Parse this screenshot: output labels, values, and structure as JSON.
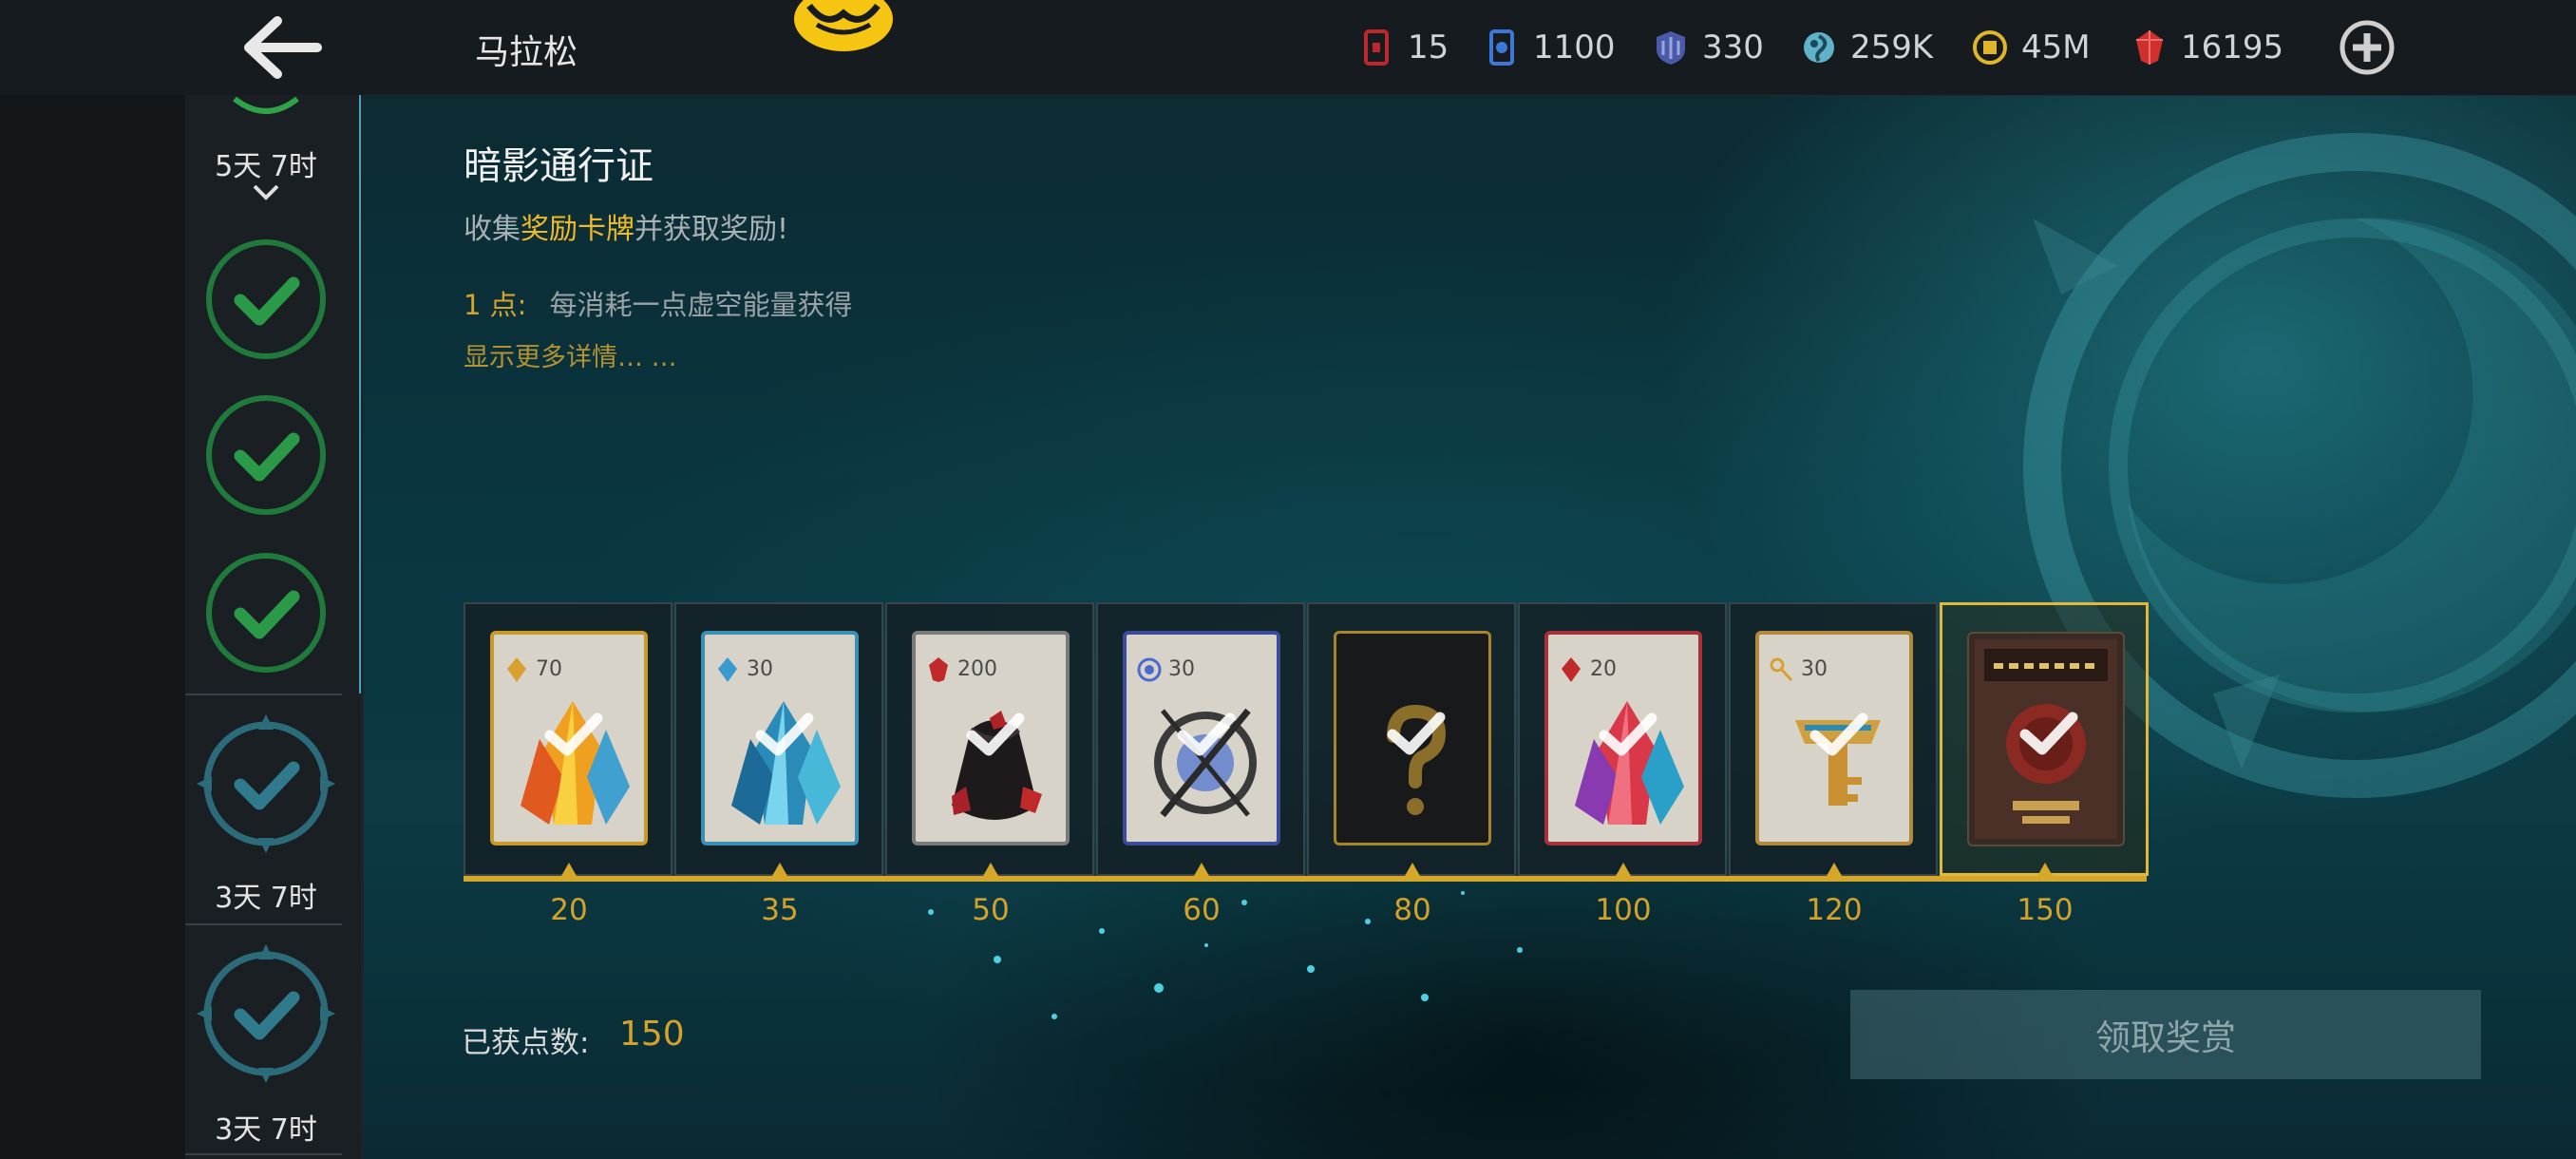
{
  "topbar": {
    "title": "马拉松",
    "resources": [
      {
        "icon": "red-card-icon",
        "value": "15",
        "color": "#c0262e"
      },
      {
        "icon": "blue-card-icon",
        "value": "1100",
        "color": "#3c78d8"
      },
      {
        "icon": "shield-token-icon",
        "value": "330",
        "color": "#6a78c8"
      },
      {
        "icon": "swirl-orb-icon",
        "value": "259K",
        "color": "#5fb2c8"
      },
      {
        "icon": "gold-coin-icon",
        "value": "45M",
        "color": "#e0b52a"
      },
      {
        "icon": "red-gem-icon",
        "value": "16195",
        "color": "#d0302c"
      }
    ]
  },
  "sidebar": {
    "items": [
      {
        "time": "5天 7时",
        "state": "completed-active"
      },
      {
        "state": "completed"
      },
      {
        "state": "completed"
      },
      {
        "state": "completed"
      },
      {
        "time": "3天 7时",
        "state": "available"
      },
      {
        "time": "3天 7时",
        "state": "available"
      }
    ]
  },
  "main": {
    "title": "暗影通行证",
    "subtitle_prefix": "收集",
    "subtitle_highlight": "奖励卡牌",
    "subtitle_suffix": "并获取奖励!",
    "point_label": "1 点:",
    "point_desc": "每消耗一点虚空能量获得",
    "more_details": "显示更多详情… …",
    "rewards": [
      {
        "tier": "20",
        "amount": "70",
        "item": "gold-crystal-icon",
        "frame": "#c89a2a"
      },
      {
        "tier": "35",
        "amount": "30",
        "item": "blue-crystal-icon",
        "frame": "#3a8fb4"
      },
      {
        "tier": "50",
        "amount": "200",
        "item": "red-gem-bag-icon",
        "frame": "#7a7a7a"
      },
      {
        "tier": "60",
        "amount": "30",
        "item": "shield-orb-icon",
        "frame": "#3d4c9a"
      },
      {
        "tier": "80",
        "amount": "",
        "item": "mystery-question-icon",
        "frame": "#a8852a"
      },
      {
        "tier": "100",
        "amount": "20",
        "item": "red-crystal-icon",
        "frame": "#a8323a"
      },
      {
        "tier": "120",
        "amount": "30",
        "item": "gold-key-icon",
        "frame": "#b08a3a"
      },
      {
        "tier": "150",
        "amount": "",
        "item": "shadow-fight-game-card-icon",
        "frame": "#e0b93a"
      }
    ],
    "points_label": "已获点数:",
    "points_value": "150",
    "claim_button": "领取奖赏"
  }
}
